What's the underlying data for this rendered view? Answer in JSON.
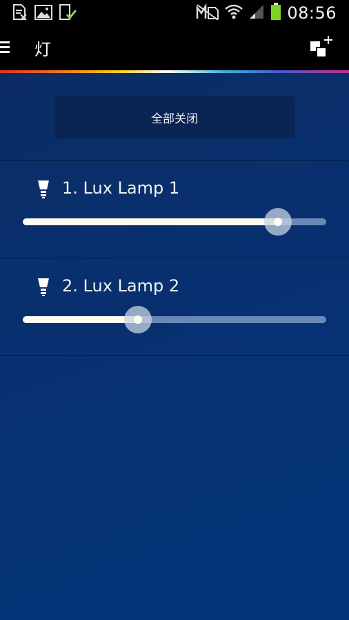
{
  "status_bar": {
    "time": "08:56",
    "left_icons": [
      "blocked-file-icon",
      "image-icon",
      "download-done-icon"
    ],
    "right_icons": [
      "no-sim-icon",
      "wifi-icon",
      "signal-icon",
      "battery-icon"
    ]
  },
  "action_bar": {
    "title": "灯",
    "menu_icon": "hamburger-menu-icon",
    "action_icon": "add-scene-icon"
  },
  "controls": {
    "all_off_label": "全部关闭"
  },
  "lamps": [
    {
      "name": "1. Lux Lamp 1",
      "brightness": 0.84,
      "icon": "bulb-icon"
    },
    {
      "name": "2. Lux Lamp 2",
      "brightness": 0.38,
      "icon": "bulb-icon"
    }
  ],
  "colors": {
    "background_top": "#0b2c63",
    "background_bottom": "#02357a",
    "slider_fill": "#fffdf0",
    "battery": "#7ed321"
  }
}
